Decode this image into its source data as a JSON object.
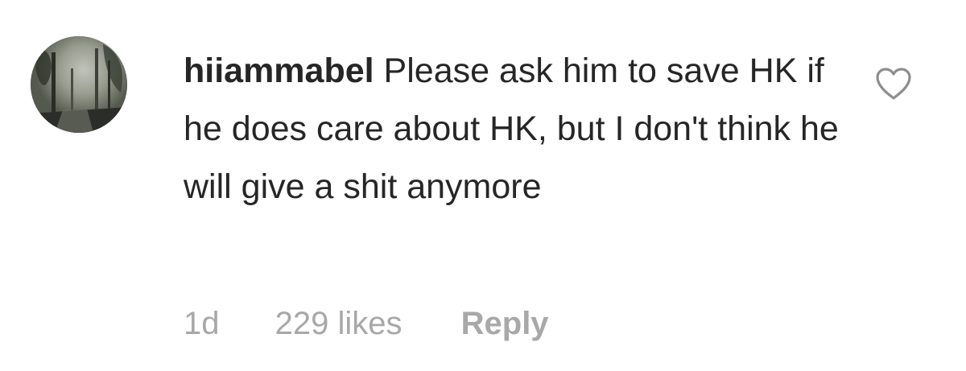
{
  "comment": {
    "username": "hiiammabel",
    "text": "Please ask him to save HK if he does care about HK, but I don't think he will give a shit anymore",
    "timestamp": "1d",
    "likes": "229 likes",
    "reply_label": "Reply",
    "avatar_icon": "profile-photo-trees",
    "like_icon": "heart-outline-icon"
  },
  "colors": {
    "text": "#262626",
    "meta": "#a8a8a8",
    "background": "#ffffff"
  }
}
